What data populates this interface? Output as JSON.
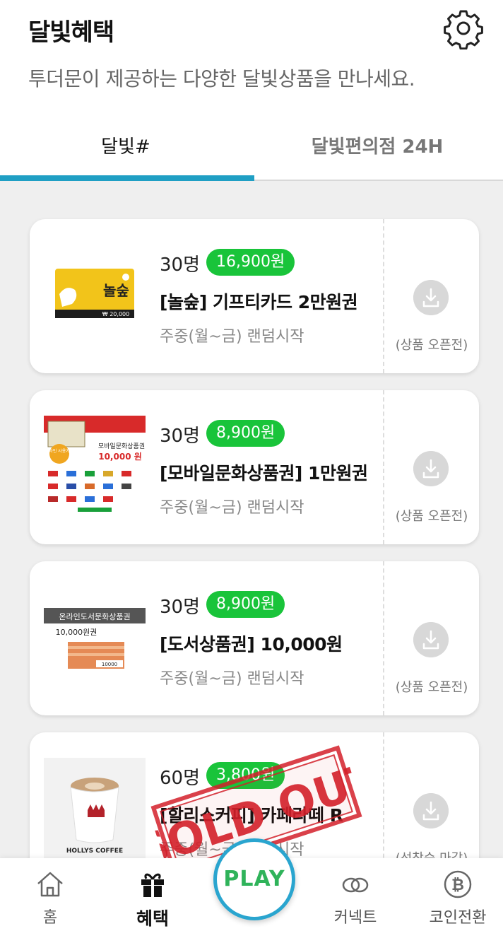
{
  "header": {
    "title": "달빛혜택",
    "subtitle": "투더문이 제공하는 다양한 달빛상품을 만나세요.",
    "settings_icon": "gear-icon"
  },
  "tabs": [
    {
      "label": "달빛#",
      "active": true
    },
    {
      "label": "달빛편의점 24H",
      "active": false
    }
  ],
  "accent_color": "#1f9fc4",
  "price_color": "#19c43a",
  "products": [
    {
      "count": "30명",
      "price": "16,900원",
      "name": "[놀숲] 기프티카드 2만원권",
      "schedule": "주중(월~금) 랜덤시작",
      "status": "(상품 오픈전)",
      "thumb_text": "₩ 20,000"
    },
    {
      "count": "30명",
      "price": "8,900원",
      "name": "[모바일문화상품권] 1만원권",
      "schedule": "주중(월~금) 랜덤시작",
      "status": "(상품 오픈전)",
      "thumb_title": "모바일문화상품권",
      "thumb_value": "10,000 원",
      "thumb_badge": "온라인 사용가능"
    },
    {
      "count": "30명",
      "price": "8,900원",
      "name": "[도서상품권] 10,000원",
      "schedule": "주중(월~금) 랜덤시작",
      "status": "(상품 오픈전)",
      "thumb_header": "온라인도서문화상품권",
      "thumb_value": "10,000원권",
      "thumb_small": "10000"
    },
    {
      "count": "60명",
      "price": "3,800원",
      "name": "[할리스커피] 카페라떼 R",
      "schedule": "주중(월~금) 랜덤시작",
      "status": "(선착순 마감)",
      "thumb_brand": "HOLLYS COFFEE",
      "stamp": "SOLD OUT"
    }
  ],
  "nav": {
    "items": [
      {
        "label": "홈",
        "icon": "home-icon"
      },
      {
        "label": "혜택",
        "icon": "gift-icon",
        "active": true
      },
      {
        "label": "커넥트",
        "icon": "link-icon"
      },
      {
        "label": "코인전환",
        "icon": "bitcoin-icon"
      }
    ],
    "play_label": "PLAY"
  }
}
